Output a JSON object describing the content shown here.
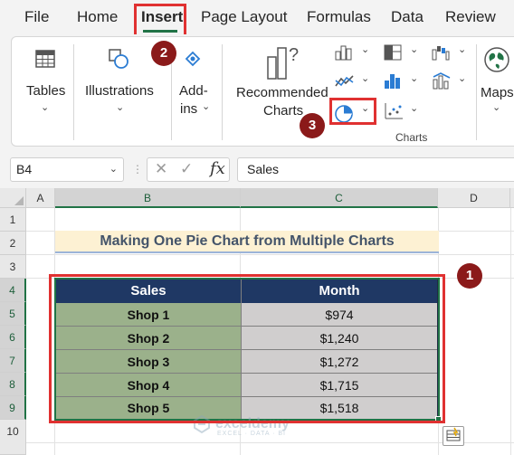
{
  "menu": {
    "tabs": [
      "File",
      "Home",
      "Insert",
      "Page Layout",
      "Formulas",
      "Data",
      "Review"
    ],
    "active_tab": "Insert"
  },
  "ribbon": {
    "tables_label": "Tables",
    "illustrations_label": "Illustrations",
    "addins_line1": "Add-",
    "addins_line2": "ins",
    "recommended_line1": "Recommended",
    "recommended_line2": "Charts",
    "maps_label": "Maps",
    "charts_group_label": "Charts",
    "icons": [
      "table-icon",
      "shapes-icon",
      "addins-icon",
      "recommended-charts-icon",
      "column-chart-icon",
      "hierarchy-chart-icon",
      "waterfall-chart-icon",
      "line-chart-icon",
      "statistic-chart-icon",
      "combo-chart-icon",
      "pie-chart-icon",
      "scatter-chart-icon",
      "maps-icon"
    ]
  },
  "callouts": [
    "1",
    "2",
    "3"
  ],
  "formula_bar": {
    "name_box": "B4",
    "cancel_symbol": "✕",
    "enter_symbol": "✓",
    "fx_label": "fx",
    "content": "Sales"
  },
  "grid": {
    "columns": [
      "A",
      "B",
      "C",
      "D"
    ],
    "selected_columns": [
      "B",
      "C"
    ],
    "rows": [
      "1",
      "2",
      "3",
      "4",
      "5",
      "6",
      "7",
      "8",
      "9",
      "10"
    ],
    "selected_rows": [
      "4",
      "5",
      "6",
      "7",
      "8",
      "9"
    ],
    "title": "Making One Pie Chart from Multiple Charts"
  },
  "table": {
    "headers": [
      "Sales",
      "Month"
    ],
    "rows": [
      [
        "Shop 1",
        "$974"
      ],
      [
        "Shop 2",
        "$1,240"
      ],
      [
        "Shop 3",
        "$1,272"
      ],
      [
        "Shop 4",
        "$1,715"
      ],
      [
        "Shop 5",
        "$1,518"
      ]
    ]
  },
  "watermark": {
    "name": "exceldemy",
    "tagline": "EXCEL · DATA · BI"
  },
  "colors": {
    "excel_green": "#217346",
    "callout_red": "#8b1a1a",
    "highlight_red": "#e03131",
    "table_header": "#1f3864",
    "shop_fill": "#9bb18b",
    "value_fill": "#d0cece",
    "title_fill": "#fdf1d3"
  }
}
